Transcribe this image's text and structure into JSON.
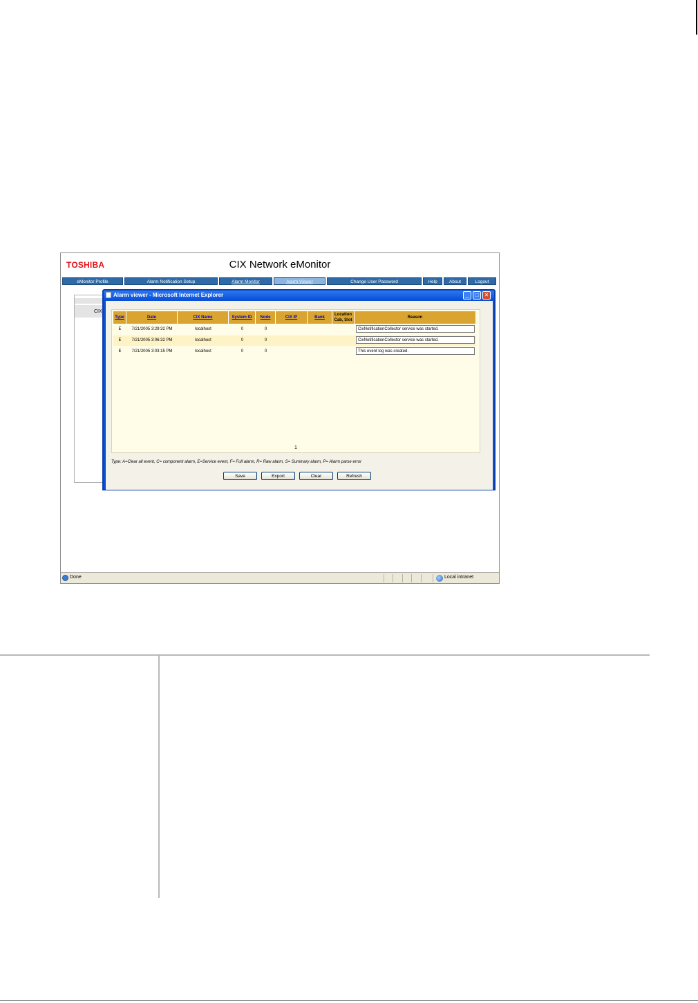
{
  "app": {
    "logo": "TOSHIBA",
    "title": "CIX Network eMonitor"
  },
  "nav": {
    "tabs": [
      {
        "label": "eMonitor Profile"
      },
      {
        "label": "Alarm Notification Setup"
      },
      {
        "label": "Alarm Monitor"
      },
      {
        "label": "Alarm Viewer"
      },
      {
        "label": "Change User Password"
      },
      {
        "label": "Help"
      },
      {
        "label": "About"
      },
      {
        "label": "Logout"
      }
    ]
  },
  "background_panel": {
    "label": "CIX I"
  },
  "popup": {
    "title": "Alarm viewer - Microsoft Internet Explorer",
    "buttons": {
      "minimize": "_",
      "maximize": "□",
      "close": "✕"
    }
  },
  "table": {
    "headers": {
      "type": "Type",
      "date": "Date",
      "cix_name": "CIX Name",
      "system_id": "System ID",
      "node": "Node",
      "cix_ip": "CIX IP",
      "bank": "Bank",
      "location_line1": "Location",
      "location_line2": "Cab, Slot",
      "reason": "Reason"
    },
    "rows": [
      {
        "type": "E",
        "date": "7/21/2005 3:29:32 PM",
        "cix_name": "localhost",
        "system_id": "0",
        "node": "0",
        "cix_ip": "",
        "bank": "",
        "location": "",
        "reason": "CixNotificationCollector service was started."
      },
      {
        "type": "E",
        "date": "7/21/2005 3:06:32 PM",
        "cix_name": "localhost",
        "system_id": "0",
        "node": "0",
        "cix_ip": "",
        "bank": "",
        "location": "",
        "reason": "CixNotificationCollector service was started."
      },
      {
        "type": "E",
        "date": "7/21/2005 3:03:15 PM",
        "cix_name": "localhost",
        "system_id": "0",
        "node": "0",
        "cix_ip": "",
        "bank": "",
        "location": "",
        "reason": "This event log was created."
      }
    ],
    "page": "1"
  },
  "legend": "Type: A=Clear all event, C= component alarm, E=Service event, F= Full alarm, R= Raw alarm, S= Summary alarm, P= Alarm parse error",
  "actions": {
    "save": "Save",
    "export": "Export",
    "clear": "Clear",
    "refresh": "Refresh"
  },
  "statusbar": {
    "left": "Done",
    "zone": "Local intranet"
  },
  "colors": {
    "brand_red": "#e0131b",
    "nav_blue": "#2e6aa8",
    "header_gold": "#d9a530",
    "row_alt": "#fdf3c6",
    "xp_title_blue": "#0a4fd6"
  },
  "icons": {
    "status": "ie-page-icon",
    "zone": "globe-icon"
  }
}
